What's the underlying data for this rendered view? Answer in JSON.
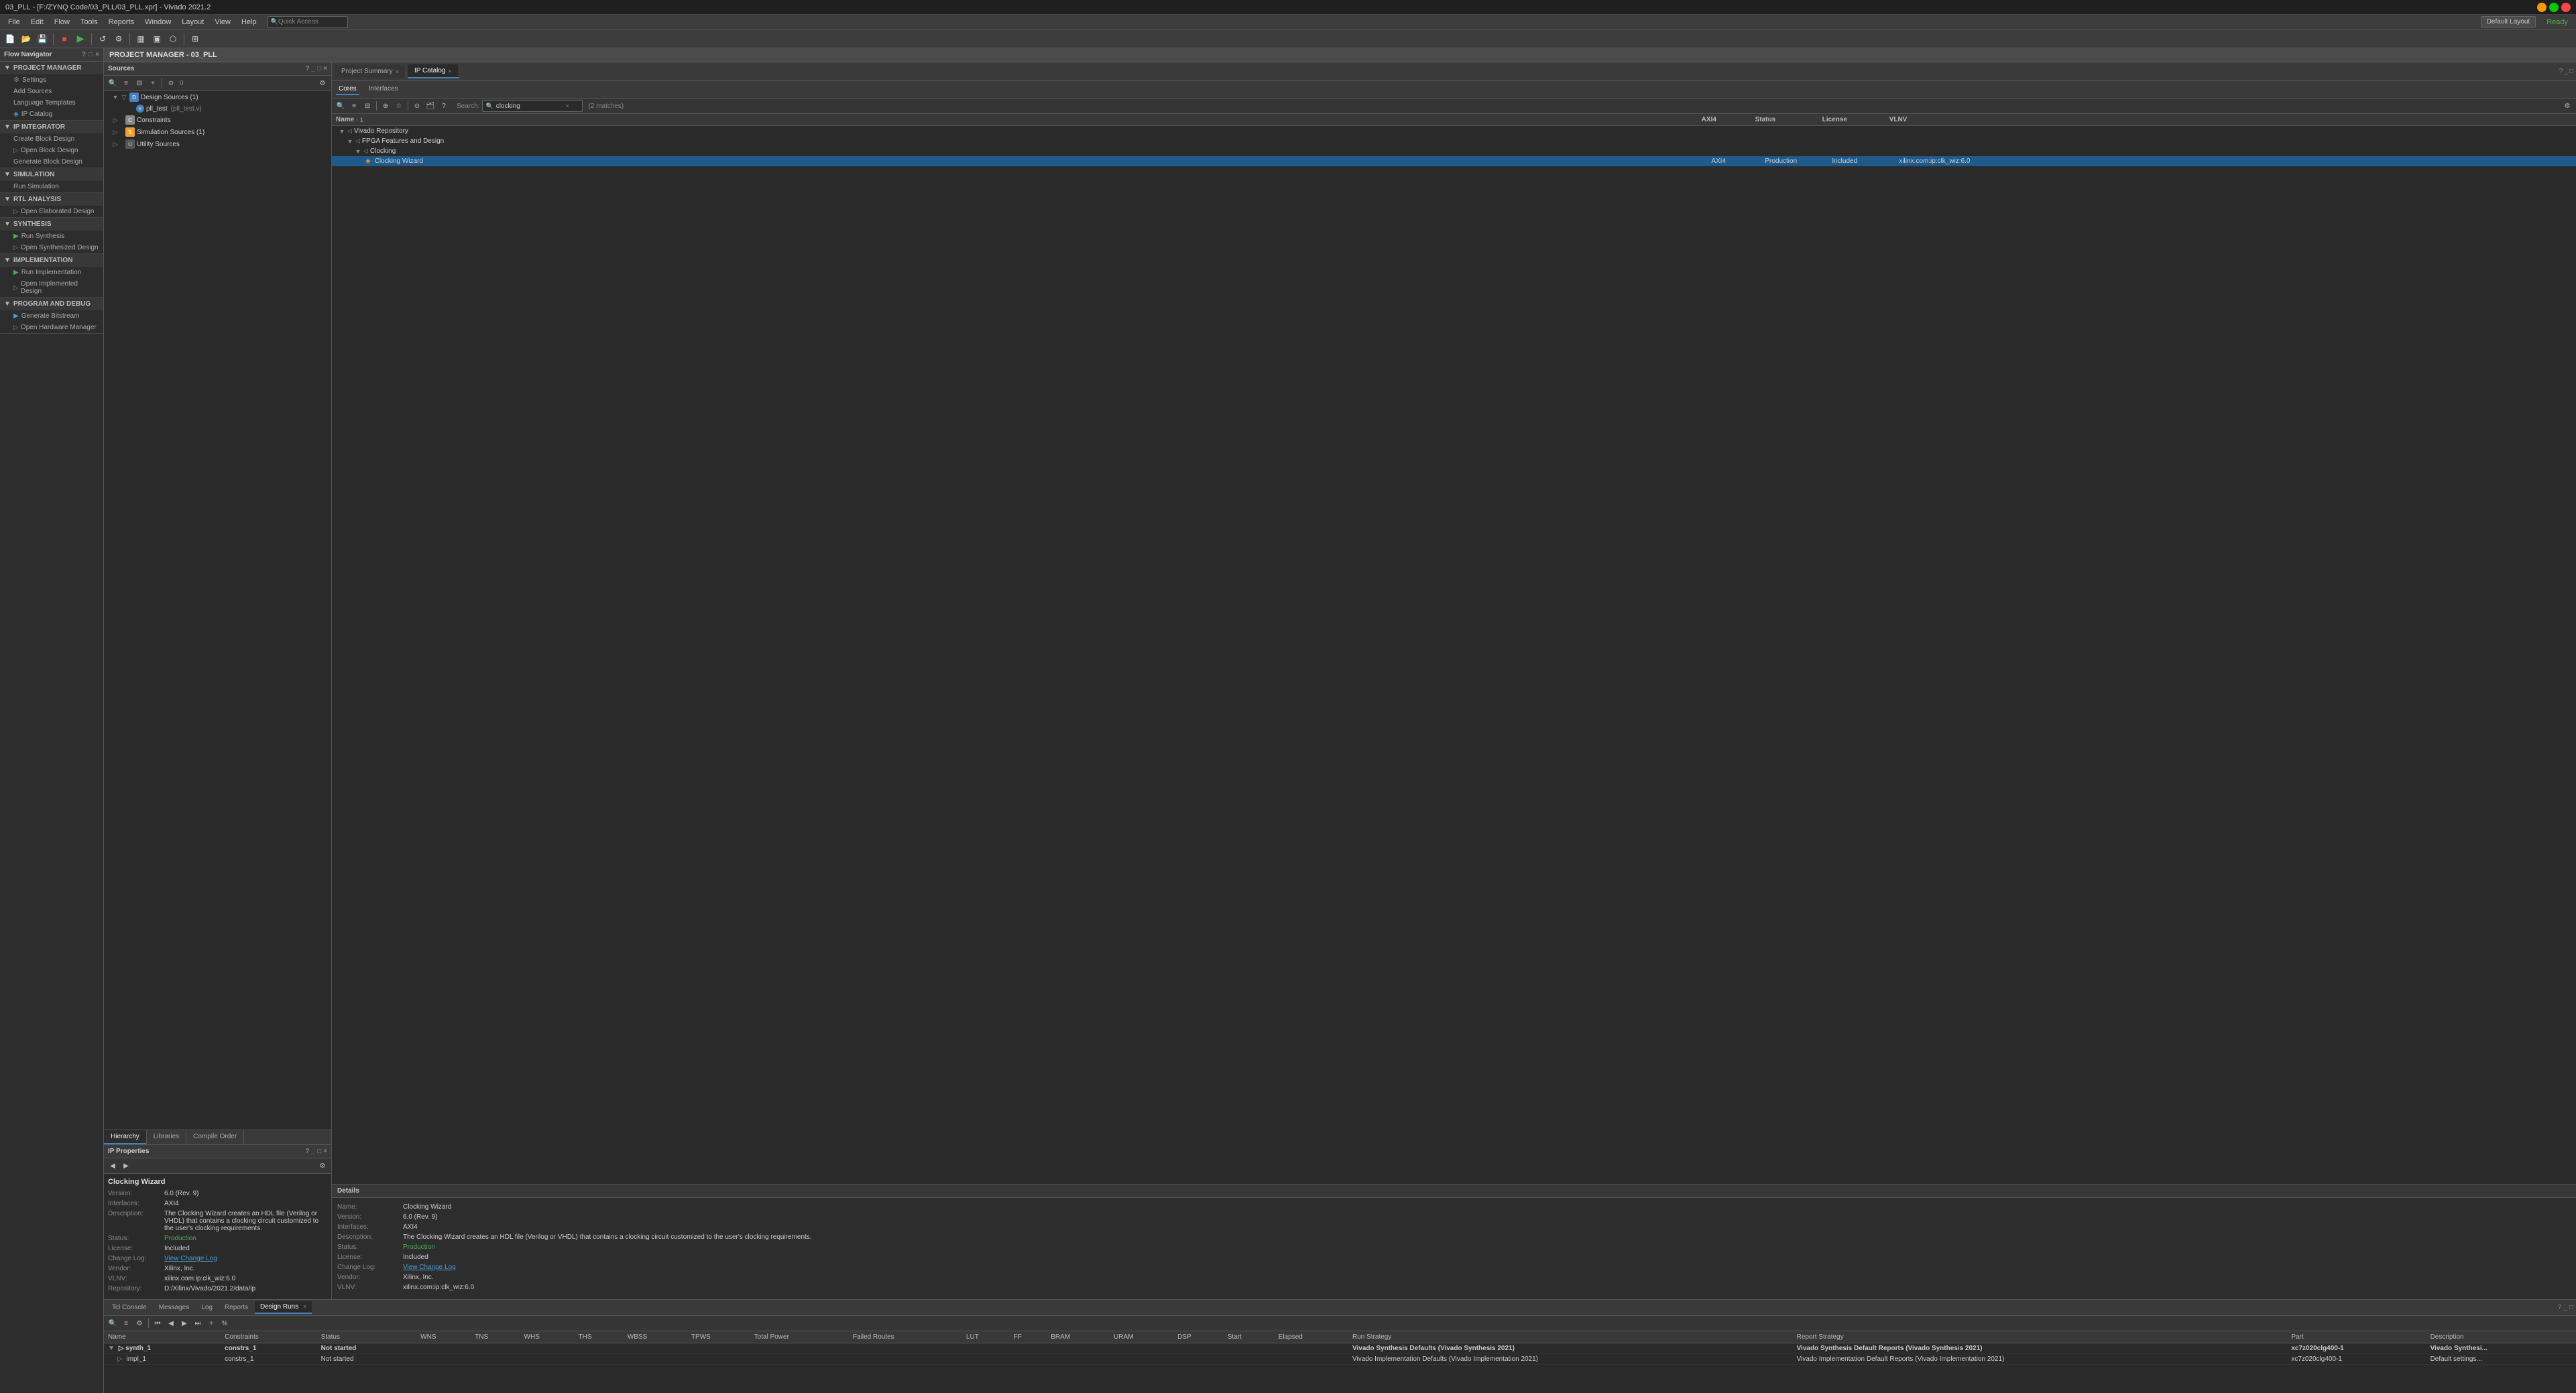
{
  "titleBar": {
    "title": "03_PLL - [F:/ZYNQ Code/03_PLL/03_PLL.xpr] - Vivado 2021.2"
  },
  "menuBar": {
    "items": [
      "File",
      "Edit",
      "Flow",
      "Tools",
      "Reports",
      "Window",
      "Layout",
      "View",
      "Help"
    ]
  },
  "toolbar": {
    "quickAccess": "Quick Access",
    "defaultLayout": "Default Layout",
    "ready": "Ready"
  },
  "flowNav": {
    "header": "Flow Navigator",
    "sections": [
      {
        "id": "project-manager",
        "label": "PROJECT MANAGER",
        "items": [
          {
            "id": "settings",
            "label": "Settings",
            "icon": "gear"
          },
          {
            "id": "add-sources",
            "label": "Add Sources",
            "indent": 1
          },
          {
            "id": "language-templates",
            "label": "Language Templates",
            "indent": 1
          },
          {
            "id": "ip-catalog",
            "label": "IP Catalog",
            "indent": 1
          }
        ]
      },
      {
        "id": "ip-integrator",
        "label": "IP INTEGRATOR",
        "items": [
          {
            "id": "create-block-design",
            "label": "Create Block Design",
            "indent": 1
          },
          {
            "id": "open-block-design",
            "label": "Open Block Design",
            "indent": 1
          },
          {
            "id": "generate-block-design",
            "label": "Generate Block Design",
            "indent": 1
          }
        ]
      },
      {
        "id": "simulation",
        "label": "SIMULATION",
        "items": [
          {
            "id": "run-simulation",
            "label": "Run Simulation",
            "indent": 1
          }
        ]
      },
      {
        "id": "rtl-analysis",
        "label": "RTL ANALYSIS",
        "items": [
          {
            "id": "open-elaborated-design",
            "label": "Open Elaborated Design",
            "indent": 1,
            "expand": true
          }
        ]
      },
      {
        "id": "synthesis",
        "label": "SYNTHESIS",
        "items": [
          {
            "id": "run-synthesis",
            "label": "Run Synthesis",
            "indent": 1,
            "run": true
          },
          {
            "id": "open-synthesized-design",
            "label": "Open Synthesized Design",
            "indent": 1,
            "expand": true
          }
        ]
      },
      {
        "id": "implementation",
        "label": "IMPLEMENTATION",
        "items": [
          {
            "id": "run-implementation",
            "label": "Run Implementation",
            "indent": 1,
            "run": true
          },
          {
            "id": "open-implemented-design",
            "label": "Open Implemented Design",
            "indent": 1,
            "expand": true
          }
        ]
      },
      {
        "id": "program-and-debug",
        "label": "PROGRAM AND DEBUG",
        "items": [
          {
            "id": "generate-bitstream",
            "label": "Generate Bitstream",
            "indent": 1,
            "run": true
          },
          {
            "id": "open-hardware-manager",
            "label": "Open Hardware Manager",
            "indent": 1,
            "expand": true
          }
        ]
      }
    ]
  },
  "pmHeader": "PROJECT MANAGER - 03_PLL",
  "sources": {
    "header": "Sources",
    "tabs": [
      {
        "id": "hierarchy",
        "label": "Hierarchy",
        "active": true
      },
      {
        "id": "libraries",
        "label": "Libraries"
      },
      {
        "id": "compile-order",
        "label": "Compile Order"
      }
    ],
    "tree": [
      {
        "id": "design-sources",
        "label": "Design Sources (1)",
        "level": 0,
        "expand": true,
        "type": "folder"
      },
      {
        "id": "pll-test",
        "label": "pll_test",
        "sublabel": "(pll_test.v)",
        "level": 1,
        "type": "verilog"
      },
      {
        "id": "constraints",
        "label": "Constraints",
        "level": 0,
        "expand": false,
        "type": "folder"
      },
      {
        "id": "sim-sources",
        "label": "Simulation Sources (1)",
        "level": 0,
        "expand": false,
        "type": "folder"
      },
      {
        "id": "utility-sources",
        "label": "Utility Sources",
        "level": 0,
        "expand": false,
        "type": "folder"
      }
    ]
  },
  "ipProperties": {
    "header": "IP Properties",
    "name": "Clocking Wizard",
    "version": "6.0 (Rev. 9)",
    "interfaces": "AXI4",
    "description": "The Clocking Wizard creates an HDL file (Verilog or VHDL) that contains a clocking circuit customized to the user's clocking requirements.",
    "status": "Production",
    "license": "Included",
    "changeLog": "View Change Log",
    "vendor": "Xilinx, Inc.",
    "vlnv": "xilinx.com:ip:clk_wiz:6.0",
    "repository": "D:/Xilinx/Vivado/2021.2/data/ip"
  },
  "ipCatalog": {
    "header": "IP Catalog",
    "tabs": [
      {
        "id": "project-summary",
        "label": "Project Summary"
      },
      {
        "id": "ip-catalog",
        "label": "IP Catalog",
        "active": true
      }
    ],
    "subTabs": [
      {
        "id": "cores",
        "label": "Cores",
        "active": true
      },
      {
        "id": "interfaces",
        "label": "Interfaces"
      }
    ],
    "search": {
      "value": "clocking",
      "matches": "(2 matches)"
    },
    "columns": [
      "Name",
      "AXI4",
      "Status",
      "License",
      "VLNV"
    ],
    "tree": [
      {
        "id": "vivado-repo",
        "label": "Vivado Repository",
        "level": 0,
        "expand": true
      },
      {
        "id": "fpga-features",
        "label": "FPGA Features and Design",
        "level": 1,
        "expand": true
      },
      {
        "id": "clocking",
        "label": "Clocking",
        "level": 2,
        "expand": true
      },
      {
        "id": "clocking-wizard",
        "label": "Clocking Wizard",
        "level": 3,
        "axi4": "AXI4",
        "status": "Production",
        "license": "Included",
        "vlnv": "xilinx.com:ip:clk_wiz:6.0",
        "selected": true,
        "type": "ip"
      }
    ]
  },
  "details": {
    "header": "Details",
    "name": "Clocking Wizard",
    "version": "6.0 (Rev. 9)",
    "interfaces": "AXI4",
    "description": "The Clocking Wizard creates an HDL file (Verilog or VHDL) that contains a clocking circuit customized to the user's clocking requirements.",
    "status": "Production",
    "license": "Included",
    "changeLog": "View Change Log",
    "vendor": "Xilinx, Inc.",
    "vlnv": "xilinx.com:ip:clk_wiz:6.0"
  },
  "bottomPanel": {
    "tabs": [
      {
        "id": "tcl-console",
        "label": "Tcl Console"
      },
      {
        "id": "messages",
        "label": "Messages"
      },
      {
        "id": "log",
        "label": "Log"
      },
      {
        "id": "reports",
        "label": "Reports"
      },
      {
        "id": "design-runs",
        "label": "Design Runs",
        "active": true
      }
    ],
    "designRuns": {
      "columns": [
        "Name",
        "Constraints",
        "Status",
        "WNS",
        "TNS",
        "WHS",
        "THS",
        "WBSS",
        "TPWS",
        "Total Power",
        "Failed Routes",
        "LUT",
        "FF",
        "BRAM",
        "URAM",
        "DSP",
        "Start",
        "Elapsed",
        "Run Strategy",
        "Report Strategy",
        "Part",
        "Description"
      ],
      "rows": [
        {
          "name": "synth_1",
          "constraints": "constrs_1",
          "status": "Not started",
          "wns": "",
          "tns": "",
          "whs": "",
          "ths": "",
          "wbss": "",
          "tpws": "",
          "totalPower": "",
          "failedRoutes": "",
          "lut": "",
          "ff": "",
          "bram": "",
          "uram": "",
          "dsp": "",
          "start": "",
          "elapsed": "",
          "runStrategy": "Vivado Synthesis Defaults (Vivado Synthesis 2021)",
          "reportStrategy": "Vivado Synthesis Default Reports (Vivado Synthesis 2021)",
          "part": "xc7z020clg400-1",
          "description": "Vivado Synthesi...",
          "isParent": true,
          "children": [
            {
              "name": "impl_1",
              "constraints": "constrs_1",
              "status": "Not started",
              "runStrategy": "Vivado Implementation Defaults (Vivado Implementation 2021)",
              "reportStrategy": "Vivado Implementation Default Reports (Vivado Implementation 2021)",
              "part": "xc7z020clg400-1",
              "description": "Default settings..."
            }
          ]
        }
      ]
    }
  }
}
